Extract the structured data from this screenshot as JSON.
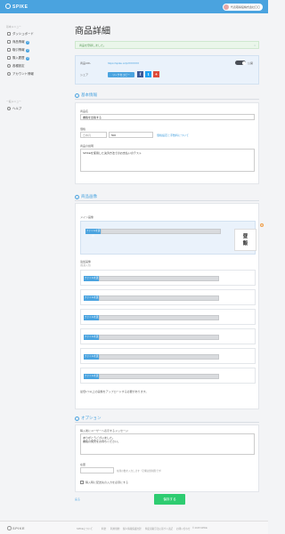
{
  "header": {
    "logo": "SPIKE",
    "user_name": "代表取締役株式会社〇〇"
  },
  "sidebar": {
    "section1": "基本メニュー",
    "items": [
      {
        "label": "ダッシュボード",
        "badge": ""
      },
      {
        "label": "商品情報",
        "badge": "1"
      },
      {
        "label": "取引情報",
        "badge": "1"
      },
      {
        "label": "購入履歴",
        "badge": "1"
      },
      {
        "label": "各種設定",
        "badge": ""
      },
      {
        "label": "アカウント情報",
        "badge": ""
      }
    ],
    "section2": "一般メニュー",
    "help": "ヘルプ"
  },
  "main": {
    "title": "商品詳細",
    "alert": "商品を登録しました。",
    "url_label": "商品URL",
    "url_value": "https://spike.cc/p/XXXXXX",
    "toggle_label": "公開",
    "share_label": "シェア",
    "share_button": "リンクをコピー",
    "basic_section": "基本情報",
    "name_label": "商品名",
    "name_value": "書籍を出版する",
    "price_label": "価格",
    "price_currency": "日本円",
    "price_value": "500",
    "price_link": "価格設定と手数料について",
    "desc_label": "商品の説明",
    "desc_value": "SPIKEを使用した決済方法でのお支払いのテスト",
    "image_section": "商品画像",
    "main_image_label": "メイン画像",
    "file_button": "ファイルを選択",
    "preview_text_1": "昼",
    "preview_text_2": "飯",
    "extra_images_label": "追加画像",
    "extra_images_sub": "(任意入力)",
    "image_note": "最低1つ以上の画像をアップロードする必要があります。",
    "option_section": "オプション",
    "message_label": "購入後にユーザーへ表示するメッセージ",
    "message_line1": "ありがとうございました。",
    "message_line2": "書籍の発売をお待ちください。",
    "stock_label": "在庫",
    "stock_hint": "在庫の数を入力します（空欄は無制限です）",
    "shipping_label": "購入時に配送先の入力を必須にする",
    "back_link": "戻る",
    "save_button": "保存する"
  },
  "footer": {
    "logo": "SPIKE",
    "links": [
      "SPIKEについて",
      "料金",
      "利用規約",
      "個人情報保護方針",
      "特定商取引法に基づく表記",
      "お問い合わせ",
      "© 2015 SPIKE"
    ]
  },
  "colors": {
    "accent": "#4aa3df",
    "save": "#2ecc71",
    "alert_bg": "#eaf6ea",
    "facebook": "#3b5998",
    "twitter": "#1da1f2",
    "google": "#dd4b39"
  }
}
